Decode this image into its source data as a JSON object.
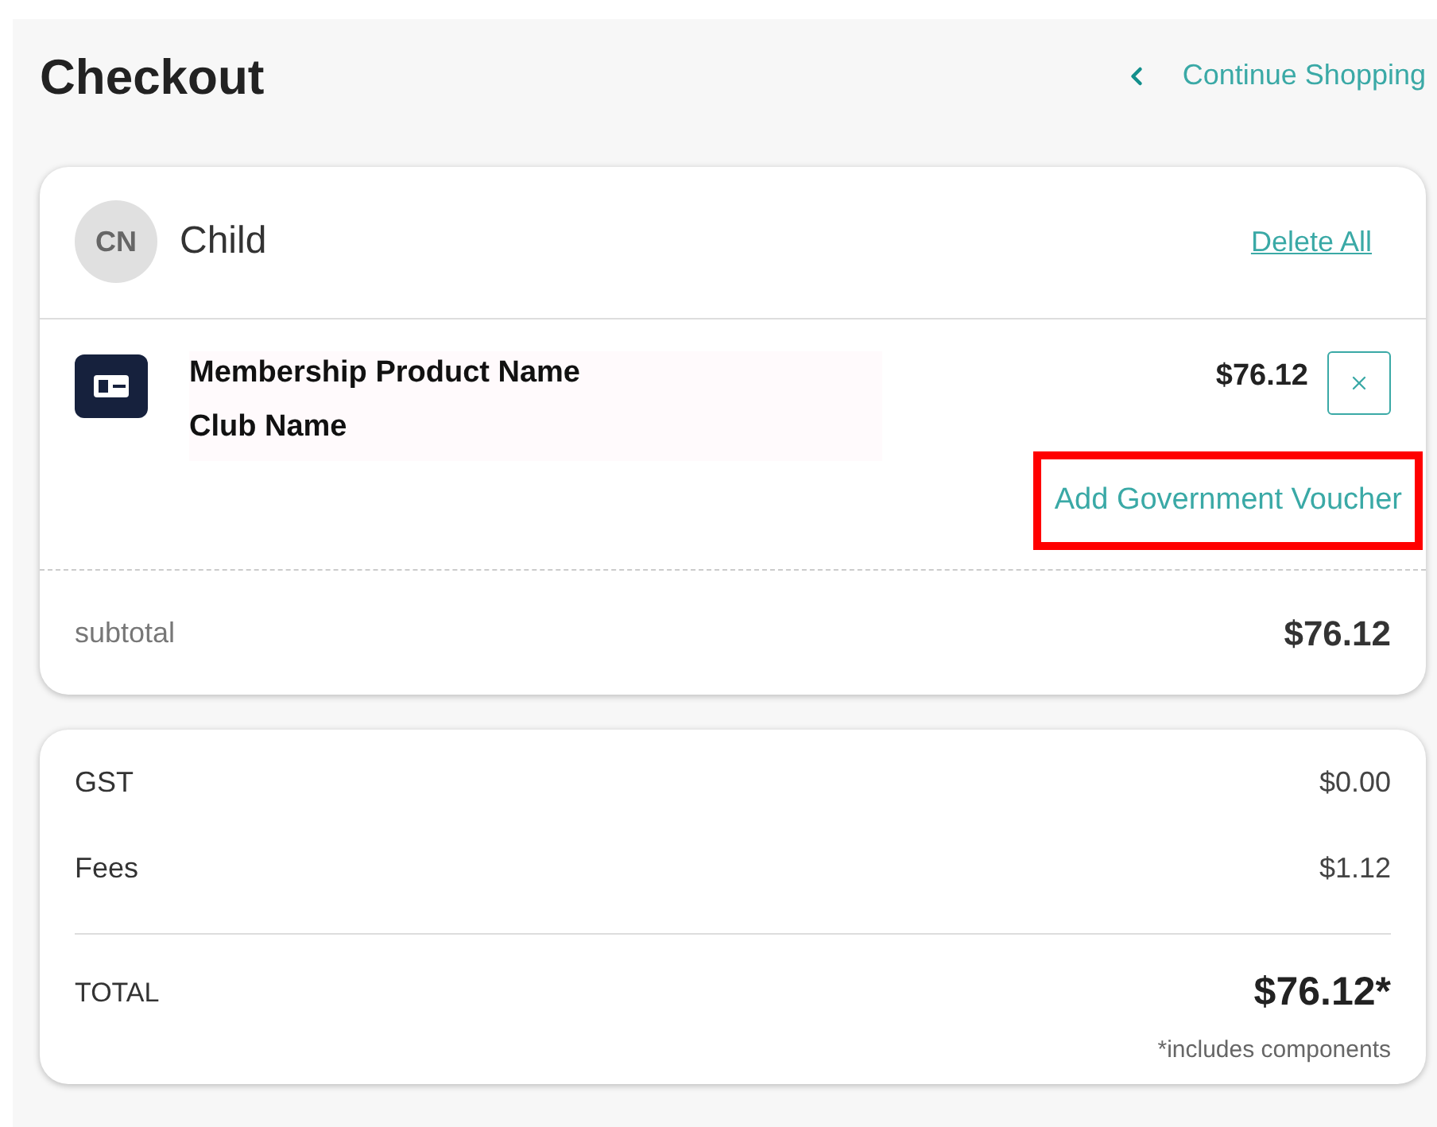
{
  "header": {
    "title": "Checkout",
    "back_link": "Continue Shopping"
  },
  "member": {
    "initials": "CN",
    "name": "Child",
    "delete_all": "Delete All"
  },
  "item": {
    "product": "Membership Product Name",
    "club": "Club Name",
    "price": "$76.12",
    "voucher_link": "Add Government Voucher",
    "highlighted": true
  },
  "subtotal": {
    "label": "subtotal",
    "value": "$76.12"
  },
  "summary": [
    {
      "label": "GST",
      "value": "$0.00"
    },
    {
      "label": "Fees",
      "value": "$1.12"
    }
  ],
  "total": {
    "label": "TOTAL",
    "value": "$76.12*",
    "note": "*includes components"
  }
}
